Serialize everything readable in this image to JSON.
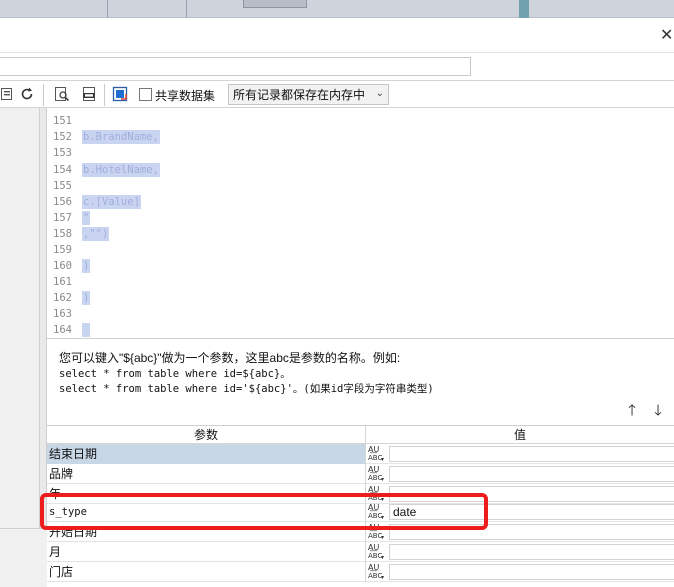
{
  "window": {
    "close_glyph": "✕"
  },
  "dataset_name_input": {
    "value": ""
  },
  "toolbar": {
    "share_dataset_label": "共享数据集",
    "storage_mode": "所有记录都保存在内存中",
    "icons": [
      "preview-icon",
      "sql-icon",
      "export-icon",
      "refresh-icon"
    ]
  },
  "editor": {
    "lines": [
      {
        "num": "151",
        "text": ""
      },
      {
        "num": "152",
        "text": "b.BrandName,"
      },
      {
        "num": "153",
        "text": ""
      },
      {
        "num": "154",
        "text": "b.HotelName,"
      },
      {
        "num": "155",
        "text": ""
      },
      {
        "num": "156",
        "text": "c.[Value]"
      },
      {
        "num": "157",
        "text": "\""
      },
      {
        "num": "158",
        "text": ",\"\")"
      },
      {
        "num": "159",
        "text": ""
      },
      {
        "num": "160",
        "text": ")"
      },
      {
        "num": "161",
        "text": ""
      },
      {
        "num": "162",
        "text": ")"
      },
      {
        "num": "163",
        "text": ""
      },
      {
        "num": "164",
        "text": " "
      }
    ]
  },
  "hint": {
    "line1": "您可以键入\"${abc}\"做为一个参数，这里abc是参数的名称。例如:",
    "line2": "select * from table where id=${abc}。",
    "line3": "select * from table where id='${abc}'。(如果id字段为字符串类型)"
  },
  "params": {
    "header_name": "参数",
    "header_value": "值",
    "type_glyph_top": "A͟U",
    "type_glyph_bottom": "ABC",
    "rows": [
      {
        "name": "结束日期",
        "value": ""
      },
      {
        "name": "品牌",
        "value": ""
      },
      {
        "name": "年",
        "value": ""
      },
      {
        "name": "s_type",
        "value": "date"
      },
      {
        "name": "开始日期",
        "value": ""
      },
      {
        "name": "月",
        "value": ""
      },
      {
        "name": "门店",
        "value": ""
      }
    ]
  },
  "colors": {
    "selection": "#c9d4f0",
    "highlight_border": "#ee1c1c",
    "selected_row": "#c7d7e6"
  }
}
